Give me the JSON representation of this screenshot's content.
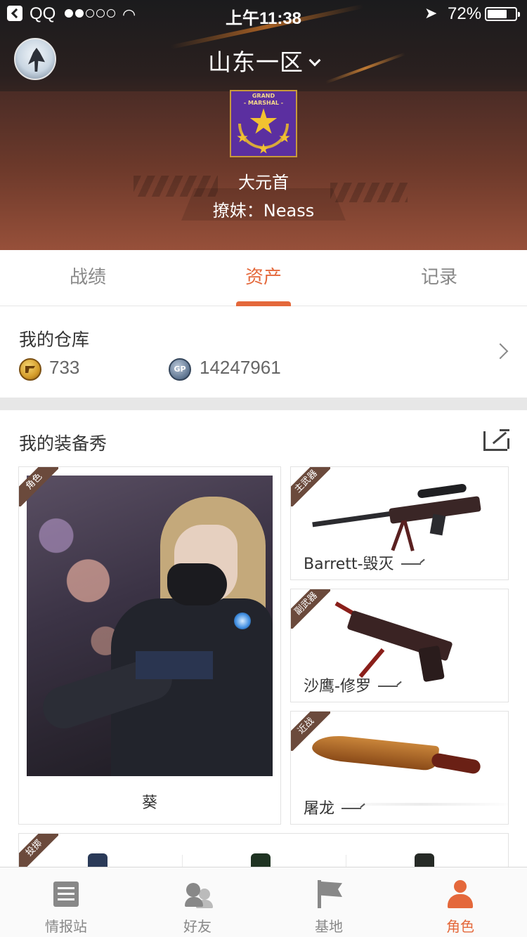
{
  "status_bar": {
    "carrier": "QQ",
    "time": "上午11:38",
    "battery": "72%",
    "battery_level": 0.72,
    "signal_bars": 2,
    "signal_total": 5
  },
  "header": {
    "server": "山东一区",
    "badge_text_1": "GRAND",
    "badge_text_2": "- MARSHAL -",
    "rank": "大元首",
    "nickname": "撩妹：Neass"
  },
  "tabs": [
    {
      "label": "战绩",
      "active": false
    },
    {
      "label": "资产",
      "active": true
    },
    {
      "label": "记录",
      "active": false
    }
  ],
  "warehouse": {
    "title": "我的仓库",
    "cf_points": "733",
    "gp_icon_text": "GP",
    "gp_points": "14247961"
  },
  "equipment": {
    "title": "我的装备秀",
    "role": {
      "tag": "角色",
      "name": "葵"
    },
    "weapons": [
      {
        "tag": "主武器",
        "name": "Barrett-毁灭"
      },
      {
        "tag": "副武器",
        "name": "沙鹰-修罗"
      },
      {
        "tag": "近战",
        "name": "屠龙"
      }
    ],
    "throwables": {
      "tag": "投掷"
    }
  },
  "bottom_nav": [
    {
      "label": "情报站",
      "icon": "news-icon",
      "active": false
    },
    {
      "label": "好友",
      "icon": "friends-icon",
      "active": false
    },
    {
      "label": "基地",
      "icon": "flag-icon",
      "active": false
    },
    {
      "label": "角色",
      "icon": "person-icon",
      "active": true
    }
  ],
  "colors": {
    "accent": "#e4683b",
    "ribbon": "#6b4a3c"
  }
}
